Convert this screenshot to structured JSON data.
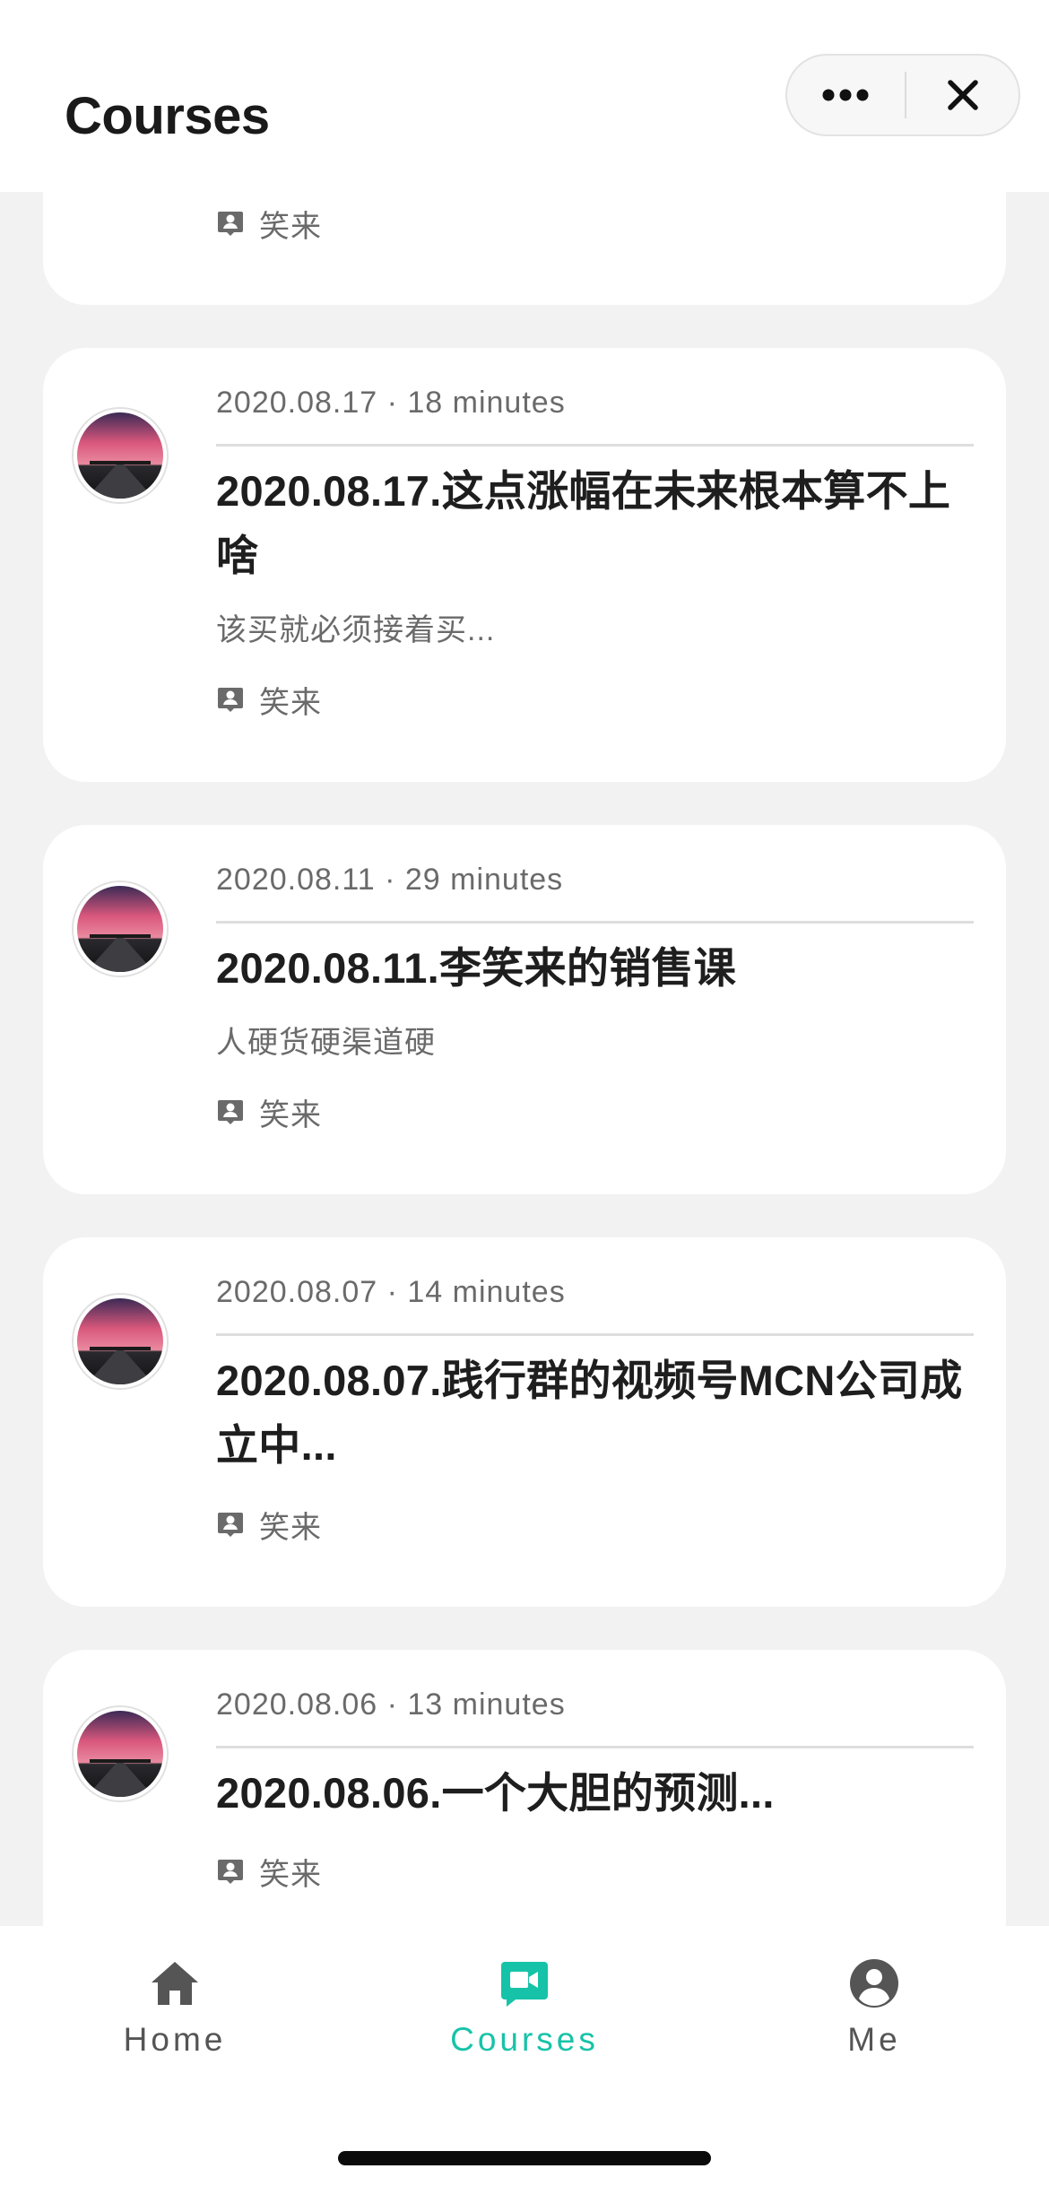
{
  "header": {
    "title": "Courses",
    "more_icon": "more-dots-icon",
    "close_icon": "close-icon"
  },
  "author_icon": "person-badge-icon",
  "courses": [
    {
      "meta": "",
      "title": "",
      "summary": "",
      "author": "笑来"
    },
    {
      "meta": "2020.08.17 · 18 minutes",
      "title": "2020.08.17.这点涨幅在未来根本算不上啥",
      "summary": "该买就必须接着买...",
      "author": "笑来"
    },
    {
      "meta": "2020.08.11 · 29 minutes",
      "title": "2020.08.11.李笑来的销售课",
      "summary": "人硬货硬渠道硬",
      "author": "笑来"
    },
    {
      "meta": "2020.08.07 · 14 minutes",
      "title": "2020.08.07.践行群的视频号MCN公司成立中...",
      "summary": "",
      "author": "笑来"
    },
    {
      "meta": "2020.08.06 · 13 minutes",
      "title": "2020.08.06.一个大胆的预测...",
      "summary": "",
      "author": "笑来"
    }
  ],
  "tabbar": {
    "items": [
      {
        "label": "Home",
        "icon": "home-icon",
        "active": false
      },
      {
        "label": "Courses",
        "icon": "video-camera-icon",
        "active": true
      },
      {
        "label": "Me",
        "icon": "user-circle-icon",
        "active": false
      }
    ]
  },
  "colors": {
    "accent": "#17c3a8",
    "background": "#f2f2f2",
    "card": "#ffffff",
    "text_primary": "#1e1e1e",
    "text_secondary": "#6a6a6a",
    "tab_inactive": "#555555"
  }
}
